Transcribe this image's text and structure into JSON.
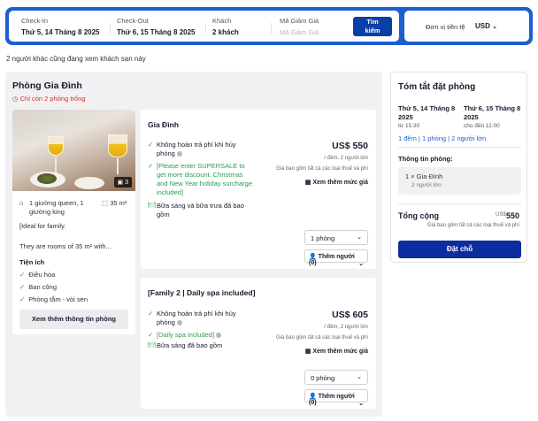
{
  "search": {
    "checkin_label": "Check-In",
    "checkin_value": "Thứ 5, 14 Tháng 8 2025",
    "checkout_label": "Check-Out",
    "checkout_value": "Thứ 6, 15 Tháng 8 2025",
    "guests_label": "Khách",
    "guests_value": "2 khách",
    "promo_label": "Mã Giảm Giá",
    "promo_placeholder": "Mã Giảm Giá",
    "search_button_line1": "Tìm",
    "search_button_line2": "kiếm"
  },
  "currency": {
    "label": "Đơn vị tiền tệ",
    "value": "USD"
  },
  "viewing_notice": "2 người khác cũng đang xem khách sạn này",
  "room": {
    "title": "Phòng Gia Đình",
    "scarcity": "Chỉ còn 2 phòng trống",
    "photo_count": "3",
    "bed": "1 giường queen, 1 giường king",
    "size": "35 m²",
    "description_1": "[Ideal for family.",
    "description_2": "They are rooms of 35 m² with...",
    "amenities_title": "Tiện ích",
    "amenities": [
      "Điều hòa",
      "Ban công",
      "Phòng tắm - vòi sen"
    ],
    "more_info_button": "Xem thêm thông tin phòng"
  },
  "rates": [
    {
      "name": "Gia Đình",
      "features": [
        "Không hoàn trả phí khi hủy phòng",
        "[Please enter SUPERSALE to get more discount. Christmas and New Year holiday surcharge included]",
        "Bữa sáng và bữa trưa đã bao gồm"
      ],
      "price": "US$ 550",
      "per_night": "/ đêm, 2 người lớn",
      "tax_note": "Giá bao gồm tất cả các loại thuế và phí",
      "more_rates": "Xem thêm mức giá",
      "rooms_select": "1 phòng",
      "add_guests": "Thêm người (0)"
    },
    {
      "name": "[Family 2 | Daily spa included]",
      "features": [
        "Không hoàn trả phí khi hủy phòng",
        "[Daily spa included]",
        "Bữa sáng đã bao gồm"
      ],
      "price": "US$ 605",
      "per_night": "/ đêm, 2 người lớn",
      "tax_note": "Giá bao gồm tất cả các loại thuế và phí",
      "more_rates": "Xem thêm mức giá",
      "rooms_select": "0 phòng",
      "add_guests": "Thêm người (0)"
    }
  ],
  "summary": {
    "title": "Tóm tắt đặt phòng",
    "checkin_date": "Thứ 5, 14 Tháng 8 2025",
    "checkin_time": "từ 15:30",
    "checkout_date": "Thứ 6, 15 Tháng 8 2025",
    "checkout_time": "cho đến 11:00",
    "meta": "1 đêm  |  1 phòng  |  2 người lớn",
    "rooms_label": "Thông tin phòng:",
    "room_line": "1 × Gia Đình",
    "room_guests": "2 người lớn",
    "total_label": "Tổng cộng",
    "total_currency": "US$",
    "total_value": "550",
    "total_note": "Giá bao gồm tất cả các loại thuế và phí",
    "book_button": "Đặt chỗ"
  },
  "colors": {
    "brand_blue": "#1b5fd0",
    "button_dark": "#0b2da0",
    "success_green": "#2a9d4a",
    "alert_red": "#d0312d"
  }
}
